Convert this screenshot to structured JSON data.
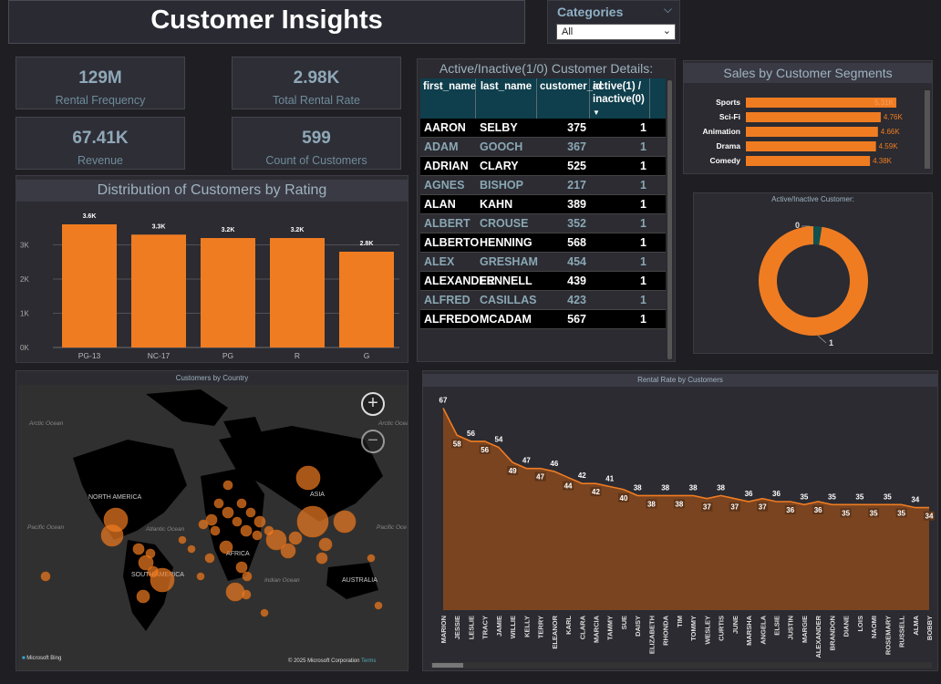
{
  "title": "Customer Insights",
  "slicer": {
    "label": "Categories",
    "value": "All"
  },
  "kpis": [
    {
      "value": "129M",
      "label": "Rental Frequency"
    },
    {
      "value": "2.98K",
      "label": "Total Rental Rate"
    },
    {
      "value": "67.41K",
      "label": "Revenue"
    },
    {
      "value": "599",
      "label": "Count of Customers"
    }
  ],
  "table": {
    "title": "Active/Inactive(1/0) Customer Details:",
    "headers": [
      "first_name",
      "last_name",
      "customer_id",
      "active(1) / inactive(0)"
    ],
    "rows": [
      [
        "AARON",
        "SELBY",
        "375",
        "1"
      ],
      [
        "ADAM",
        "GOOCH",
        "367",
        "1"
      ],
      [
        "ADRIAN",
        "CLARY",
        "525",
        "1"
      ],
      [
        "AGNES",
        "BISHOP",
        "217",
        "1"
      ],
      [
        "ALAN",
        "KAHN",
        "389",
        "1"
      ],
      [
        "ALBERT",
        "CROUSE",
        "352",
        "1"
      ],
      [
        "ALBERTO",
        "HENNING",
        "568",
        "1"
      ],
      [
        "ALEX",
        "GRESHAM",
        "454",
        "1"
      ],
      [
        "ALEXANDER",
        "FENNELL",
        "439",
        "1"
      ],
      [
        "ALFRED",
        "CASILLAS",
        "423",
        "1"
      ],
      [
        "ALFREDO",
        "MCADAM",
        "567",
        "1"
      ]
    ]
  },
  "chart_data": [
    {
      "type": "bar",
      "title": "Distribution of Customers by Rating",
      "categories": [
        "PG-13",
        "NC-17",
        "PG",
        "R",
        "G"
      ],
      "values": [
        3.6,
        3.3,
        3.2,
        3.2,
        2.8
      ],
      "data_labels": [
        "3.6K",
        "3.3K",
        "3.2K",
        "3.2K",
        "2.8K"
      ],
      "y_ticks": [
        "0K",
        "1K",
        "2K",
        "3K"
      ],
      "ylim": [
        0,
        4
      ],
      "color": "#f07c22"
    },
    {
      "type": "bar",
      "orientation": "horizontal",
      "title": "Sales by Customer Segments",
      "categories": [
        "Sports",
        "Sci-Fi",
        "Animation",
        "Drama",
        "Comedy"
      ],
      "values": [
        5.31,
        4.76,
        4.66,
        4.59,
        4.38
      ],
      "data_labels": [
        "5.31K",
        "4.76K",
        "4.66K",
        "4.59K",
        "4.38K"
      ],
      "color": "#f07c22"
    },
    {
      "type": "pie",
      "title": "Active/Inactive Customer:",
      "categories": [
        "0",
        "1"
      ],
      "values": [
        15,
        584
      ],
      "colors": [
        "#11504f",
        "#f07c22"
      ]
    },
    {
      "type": "area",
      "title": "Rental Rate by Customers",
      "categories": [
        "MARION",
        "JESSIE",
        "LESLIE",
        "TRACY",
        "JAMIE",
        "WILLIE",
        "KELLY",
        "TERRY",
        "ELEANOR",
        "KARL",
        "CLARA",
        "MARCIA",
        "TAMMY",
        "SUE",
        "DAISY",
        "ELIZABETH",
        "RHONDA",
        "TIM",
        "TOMMY",
        "WESLEY",
        "CURTIS",
        "JUNE",
        "MARSHA",
        "ANGELA",
        "ELSIE",
        "JUSTIN",
        "MARGIE",
        "ALEXANDER",
        "BRANDON",
        "DIANE",
        "LOIS",
        "NAOMI",
        "ROSEMARY",
        "RUSSELL",
        "ALMA",
        "BOBBY"
      ],
      "values": [
        67,
        58,
        56,
        56,
        54,
        49,
        47,
        47,
        46,
        44,
        42,
        42,
        41,
        40,
        38,
        38,
        38,
        38,
        38,
        37,
        38,
        37,
        36,
        37,
        36,
        36,
        35,
        36,
        35,
        35,
        35,
        35,
        35,
        35,
        34,
        34
      ],
      "color": "#7a4420"
    }
  ],
  "map": {
    "title": "Customers by Country",
    "labels": [
      "Arctic Ocean",
      "Arctic Ocean",
      "NORTH AMERICA",
      "Atlantic Ocean",
      "Pacific Ocean",
      "Pacific Oce",
      "ASIA",
      "AFRICA",
      "SOUTH AMERICA",
      "Indian Ocean",
      "AUSTRALIA"
    ],
    "credit": "© 2025 Microsoft Corporation",
    "terms": "Terms",
    "brand": "Microsoft Bing",
    "zoom_in": "+",
    "zoom_out": "−"
  },
  "colors": {
    "accent": "#f07c22",
    "header": "#0f3e4c",
    "muted": "#8fa8b7"
  }
}
